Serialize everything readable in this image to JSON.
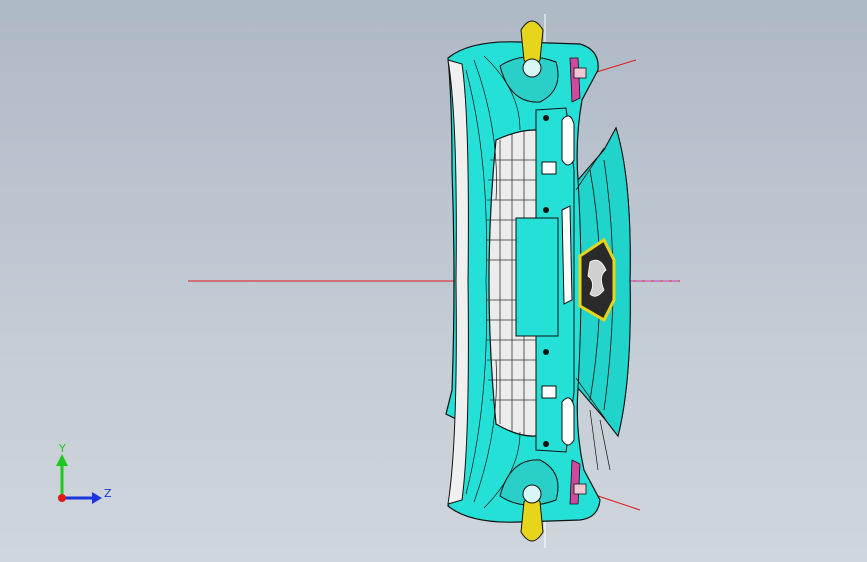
{
  "viewport": {
    "background_top": "#aeb9c6",
    "background_bottom": "#d0d6dd"
  },
  "model": {
    "part_color": "#24e0d6",
    "accent_color": "#e6d51a",
    "edge_color": "#111111",
    "reference_line_color": "#e01818"
  },
  "triad": {
    "y_label": "Y",
    "z_label": "Z",
    "y_color": "#1ec81e",
    "z_color": "#1a36e0",
    "origin_color": "#e01818"
  }
}
